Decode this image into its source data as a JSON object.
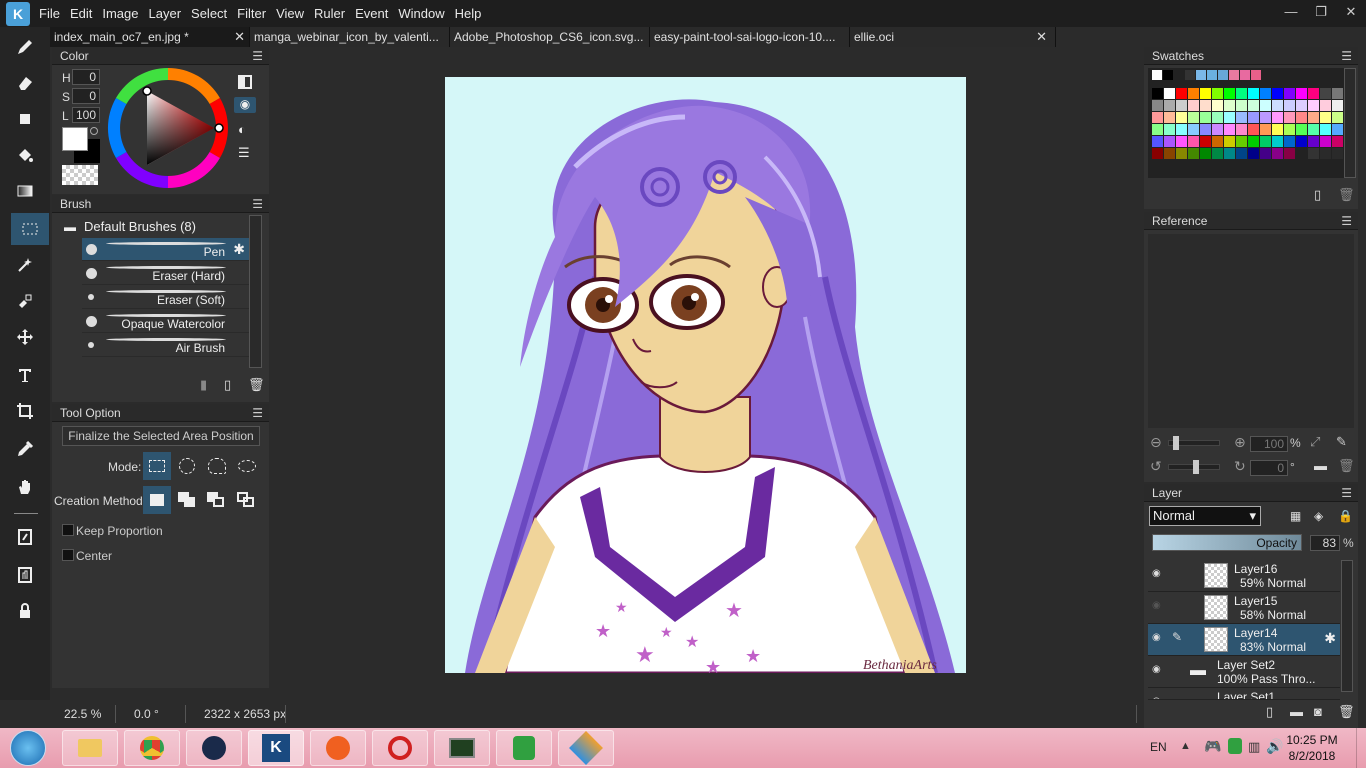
{
  "menu": [
    "File",
    "Edit",
    "Image",
    "Layer",
    "Select",
    "Filter",
    "View",
    "Ruler",
    "Event",
    "Window",
    "Help"
  ],
  "window_controls": {
    "minimize": "—",
    "restore": "❐",
    "close": "✕"
  },
  "tabs": [
    {
      "label": "index_main_oc7_en.jpg *"
    },
    {
      "label": "manga_webinar_icon_by_valenti..."
    },
    {
      "label": "Adobe_Photoshop_CS6_icon.svg..."
    },
    {
      "label": "easy-paint-tool-sai-logo-icon-10...."
    },
    {
      "label": "ellie.oci"
    }
  ],
  "color_panel": {
    "title": "Color",
    "h_label": "H",
    "h_value": "0",
    "s_label": "S",
    "s_value": "0",
    "l_label": "L",
    "l_value": "100"
  },
  "brush_panel": {
    "title": "Brush",
    "group": "Default Brushes (8)",
    "brushes": [
      "Pen",
      "Eraser (Hard)",
      "Eraser (Soft)",
      "Opaque Watercolor",
      "Air Brush"
    ]
  },
  "tool_option": {
    "title": "Tool Option",
    "finalize": "Finalize the Selected Area Position",
    "mode_label": "Mode:",
    "creation_label": "Creation Method:",
    "keep_proportion": "Keep Proportion",
    "center": "Center"
  },
  "swatches_panel": {
    "title": "Swatches"
  },
  "reference_panel": {
    "title": "Reference",
    "zoom_value": "100",
    "zoom_unit": "%",
    "angle_value": "0",
    "angle_unit": "°"
  },
  "layer_panel": {
    "title": "Layer",
    "blend_mode": "Normal",
    "opacity_label": "Opacity",
    "opacity_value": "83",
    "opacity_unit": "%",
    "layers": [
      {
        "name": "Layer16",
        "info": "59% Normal"
      },
      {
        "name": "Layer15",
        "info": "58% Normal"
      },
      {
        "name": "Layer14",
        "info": "83% Normal"
      },
      {
        "name": "Layer Set2",
        "info": "100% Pass Thro..."
      },
      {
        "name": "Layer Set1",
        "info": ""
      }
    ]
  },
  "status": {
    "zoom": "22.5 %",
    "angle": "0.0 °",
    "dimensions": "2322 x 2653 px"
  },
  "artwork": {
    "signature": "BethaniaArts"
  },
  "taskbar": {
    "lang": "EN",
    "time": "10:25 PM",
    "date": "8/2/2018"
  },
  "colors": {
    "accent": "#2e5570",
    "hair": "#8a6ad8",
    "skin": "#f0d49a",
    "bg_canvas": "#d5f7f8"
  }
}
